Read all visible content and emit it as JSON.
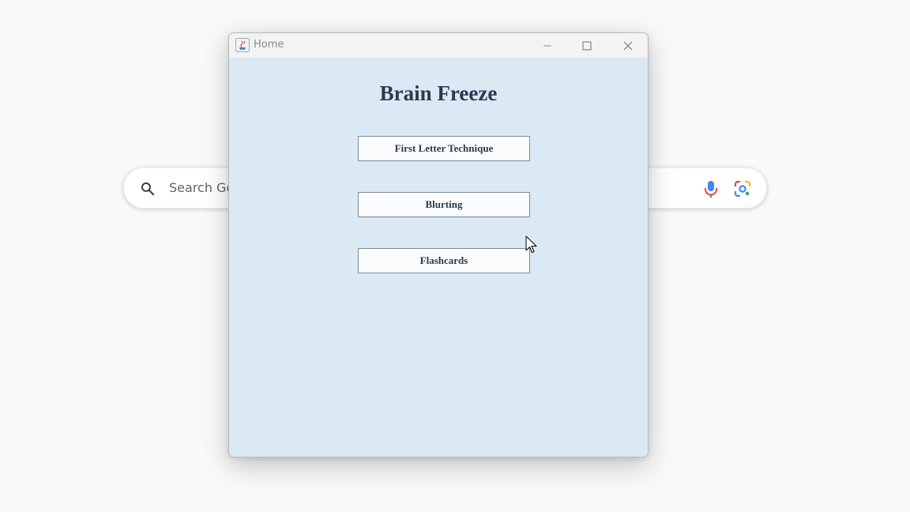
{
  "background": {
    "search_placeholder": "Search Google or type a URL",
    "icons": [
      "search-icon",
      "mic-icon",
      "lens-icon"
    ]
  },
  "window": {
    "title": "Home",
    "controls": [
      "minimize",
      "maximize",
      "close"
    ]
  },
  "app": {
    "heading": "Brain Freeze",
    "buttons": [
      {
        "label": "First Letter Technique"
      },
      {
        "label": "Blurting"
      },
      {
        "label": "Flashcards"
      }
    ]
  },
  "colors": {
    "window_bg": "#dbe9f5",
    "text": "#2d3a4e",
    "button_bg": "#fafcfe",
    "button_border": "#7f8a96"
  }
}
